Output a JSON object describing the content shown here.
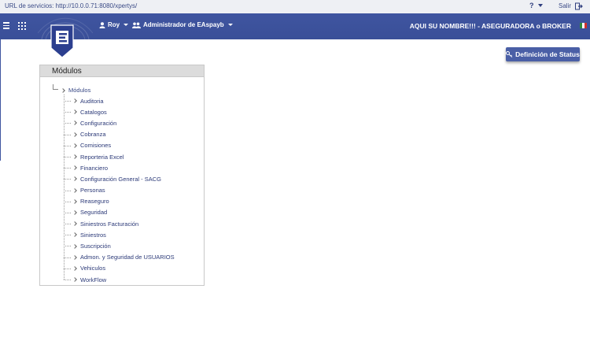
{
  "topbar": {
    "service_url": "URL de servicios: http://10.0.0.71:8080/xpertys/",
    "help_icon": "question-icon",
    "logout_label": "Salir",
    "logout_icon": "exit-icon"
  },
  "navbar": {
    "menu_icon": "hamburger-icon",
    "apps_icon": "grid-icon",
    "user_name": "Roy",
    "role": "Administrador de EAspayb",
    "company": "AQUI SU NOMBRE!!! - ASEGURADORA o BROKER",
    "flag_icon": "mexico-flag-icon",
    "colors": {
      "bar": "#3f55a0",
      "accent": "#4a5fa6"
    }
  },
  "actions": {
    "status_button": "Definición de Status",
    "status_icon": "key-icon"
  },
  "modules": {
    "title": "Módulos",
    "root_label": "Módulos",
    "items": [
      "Auditoria",
      "Catalogos",
      "Configuración",
      "Cobranza",
      "Comisiones",
      "Reporteria Excel",
      "Financiero",
      "Configuración General - SACG",
      "Personas",
      "Reaseguro",
      "Seguridad",
      "Siniestros Facturación",
      "Siniestros",
      "Suscripción",
      "Admon. y Seguridad de USUARIOS",
      "Vehiculos",
      "WorkFlow"
    ]
  }
}
